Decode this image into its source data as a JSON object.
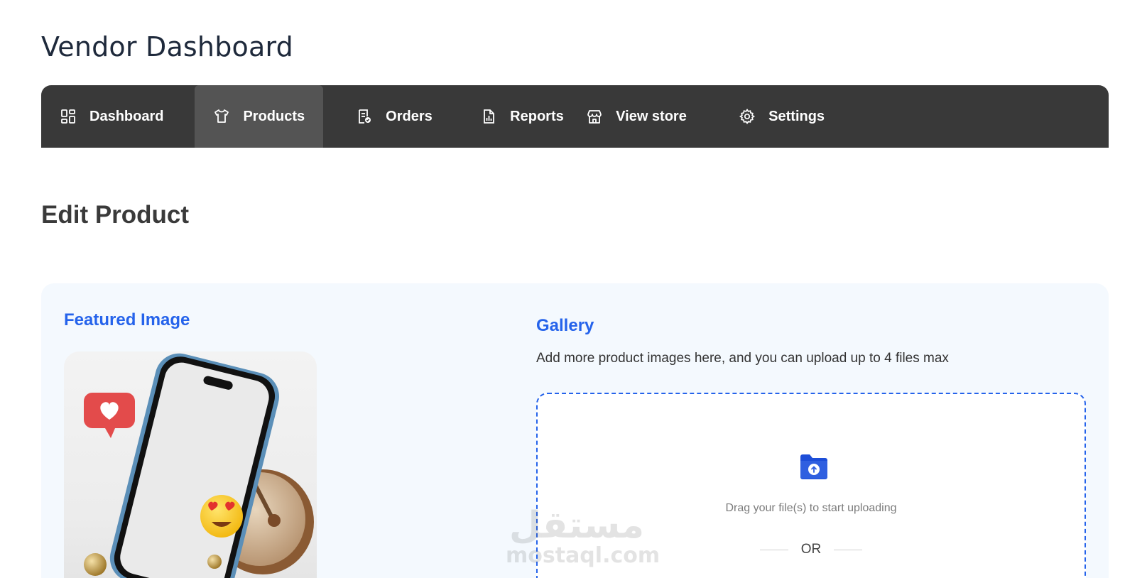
{
  "header": {
    "title": "Vendor Dashboard"
  },
  "nav": {
    "items": [
      {
        "label": "Dashboard",
        "icon": "dashboard-grid-icon",
        "active": false
      },
      {
        "label": "Products",
        "icon": "tshirt-icon",
        "active": true
      },
      {
        "label": "Orders",
        "icon": "orders-checklist-icon",
        "active": false
      },
      {
        "label": "Reports",
        "icon": "report-chart-icon",
        "active": false
      },
      {
        "label": "View store",
        "icon": "store-icon",
        "active": false
      },
      {
        "label": "Settings",
        "icon": "gear-icon",
        "active": false
      }
    ]
  },
  "main": {
    "section_title": "Edit Product",
    "featured": {
      "title": "Featured Image"
    },
    "gallery": {
      "title": "Gallery",
      "description": "Add more product images here, and you can upload up to 4 files max",
      "drop_text": "Drag your file(s) to start uploading",
      "or_text": "OR"
    }
  },
  "watermark": {
    "arabic": "مستقل",
    "latin": "mostaql.com"
  },
  "colors": {
    "nav_bg": "#393939",
    "nav_active": "#545454",
    "accent": "#2563eb",
    "panel_bg": "#f4f9fe"
  }
}
